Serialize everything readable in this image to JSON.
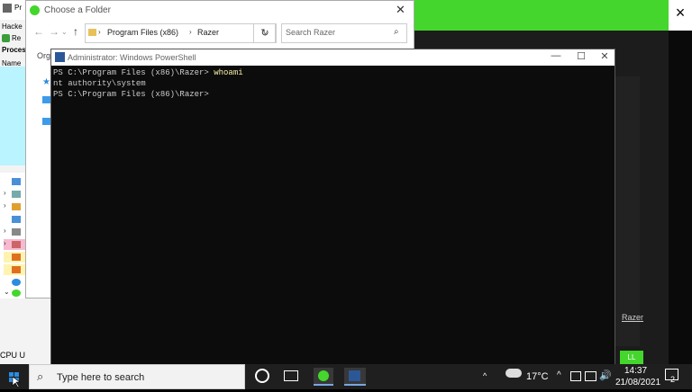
{
  "process_hacker": {
    "title_fragment": "Pr",
    "menu_fragment": "Hacke",
    "toolbar_fragment": "Re",
    "tab_fragment": "Proces",
    "column_fragment": "Name",
    "status_fragment": "CPU U"
  },
  "folder_dialog": {
    "title": "Choose a Folder",
    "path_parts": [
      "Program Files (x86)",
      "Razer"
    ],
    "search_placeholder": "Search Razer",
    "organize_fragment": "Org"
  },
  "powershell": {
    "title": "Administrator: Windows PowerShell",
    "lines": [
      {
        "prompt": "PS C:\\Program Files (x86)\\Razer> ",
        "cmd": "whoami"
      },
      {
        "prompt": "nt authority\\system",
        "cmd": ""
      },
      {
        "prompt": "PS C:\\Program Files (x86)\\Razer>",
        "cmd": ""
      }
    ]
  },
  "razer": {
    "link_fragment": "Razer",
    "button_fragment": "LL",
    "accent": "#44d62c"
  },
  "taskbar": {
    "search_placeholder": "Type here to search",
    "temperature": "17°C",
    "time": "14:37",
    "date": "21/08/2021",
    "notification_count": "2"
  }
}
